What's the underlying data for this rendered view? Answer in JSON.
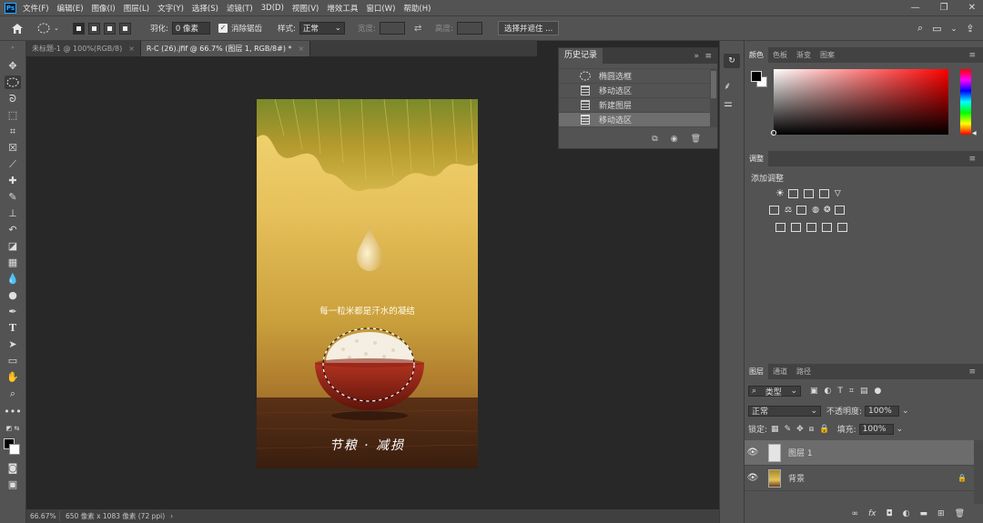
{
  "app": {
    "logo": "Ps"
  },
  "menubar": {
    "items": [
      "文件(F)",
      "编辑(E)",
      "图像(I)",
      "图层(L)",
      "文字(Y)",
      "选择(S)",
      "滤镜(T)",
      "3D(D)",
      "视图(V)",
      "增效工具",
      "窗口(W)",
      "帮助(H)"
    ],
    "window_controls": [
      "—",
      "❐",
      "✕"
    ]
  },
  "options_bar": {
    "feather_label": "羽化:",
    "feather_value": "0 像素",
    "antialias_label": "消除锯齿",
    "antialias_checked": true,
    "style_label": "样式:",
    "style_value": "正常",
    "width_label": "宽度:",
    "height_label": "高度:",
    "select_mask_button": "选择并遮住 ..."
  },
  "tabs": [
    {
      "label": "未标题-1 @ 100%(RGB/8)",
      "close": "×"
    },
    {
      "label": "R-C (26).jfif @ 66.7% (图层 1, RGB/8#) *",
      "close": "×"
    }
  ],
  "status": {
    "zoom": "66.67%",
    "info": "650 像素 x 1083 像素 (72 ppi)",
    "arrow": "›"
  },
  "poster": {
    "tagline": "每一粒米都是汗水的凝结",
    "footer": "节粮 · 减损"
  },
  "history": {
    "title": "历史记录",
    "items": [
      {
        "label": "椭圆选框",
        "icon": "ellipse-marquee-icon"
      },
      {
        "label": "移动选区",
        "icon": "history-step-icon"
      },
      {
        "label": "新建图层",
        "icon": "history-step-icon"
      },
      {
        "label": "移动选区",
        "icon": "history-step-icon"
      }
    ],
    "selected_index": 3
  },
  "color_panel": {
    "tabs": [
      "颜色",
      "色板",
      "渐变",
      "图案"
    ],
    "foreground": "#000000",
    "background": "#ffffff",
    "base_hue": "#ff0000"
  },
  "adjustments_panel": {
    "tabs": [
      "调整"
    ],
    "heading": "添加调整"
  },
  "layers_panel": {
    "tabs": [
      "图层",
      "通道",
      "路径"
    ],
    "filter_kind": "类型",
    "blend_mode": "正常",
    "opacity_label": "不透明度:",
    "opacity_value": "100%",
    "lock_label": "锁定:",
    "fill_label": "填充:",
    "fill_value": "100%",
    "layers": [
      {
        "name": "图层 1",
        "selected": true,
        "locked": false
      },
      {
        "name": "背景",
        "selected": false,
        "locked": true
      }
    ],
    "footer_icons": [
      "link-icon",
      "fx-icon",
      "mask-icon",
      "adjustment-icon",
      "group-icon",
      "new-layer-icon",
      "trash-icon"
    ]
  }
}
